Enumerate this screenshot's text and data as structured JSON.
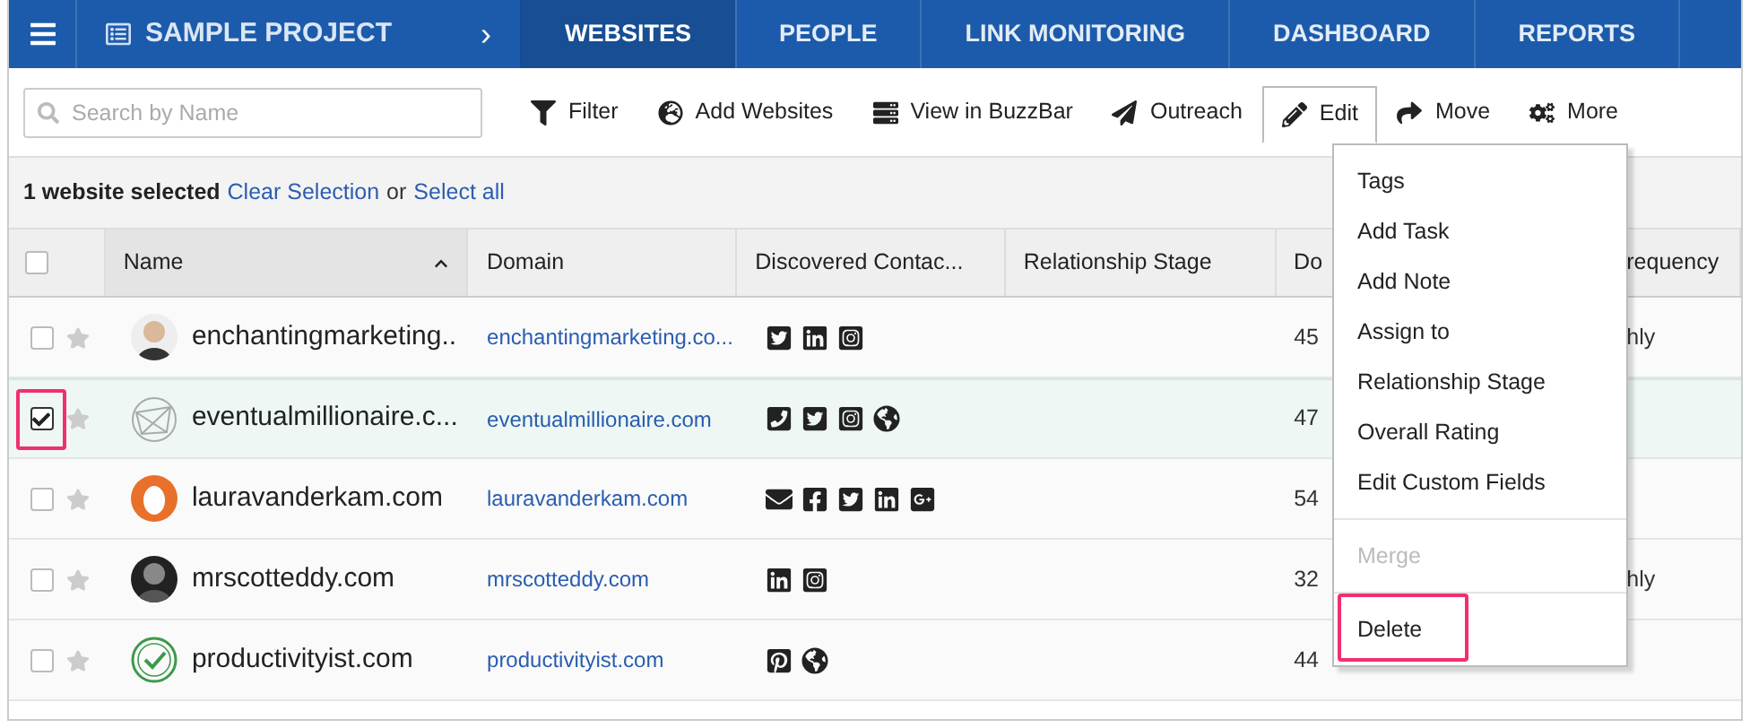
{
  "nav": {
    "project": "SAMPLE PROJECT",
    "chevron": "›",
    "tabs": [
      {
        "label": "WEBSITES",
        "selected": true
      },
      {
        "label": "PEOPLE",
        "selected": false
      },
      {
        "label": "LINK MONITORING",
        "selected": false
      },
      {
        "label": "DASHBOARD",
        "selected": false
      },
      {
        "label": "REPORTS",
        "selected": false
      }
    ]
  },
  "search": {
    "placeholder": "Search by Name"
  },
  "toolbar": [
    {
      "label": "Filter",
      "open": false
    },
    {
      "label": "Add Websites",
      "open": false
    },
    {
      "label": "View in BuzzBar",
      "open": false
    },
    {
      "label": "Outreach",
      "open": false
    },
    {
      "label": "Edit",
      "open": true
    },
    {
      "label": "Move",
      "open": false
    },
    {
      "label": "More",
      "open": false
    }
  ],
  "selection": {
    "count": "1 website selected",
    "clear": "Clear Selection",
    "or": "or",
    "select_all": "Select all"
  },
  "table": {
    "all_checked": false,
    "sort_ascending": true,
    "columns": [
      "Name",
      "Domain",
      "Discovered Contac...",
      "Relationship Stage",
      "Do",
      "requency"
    ],
    "rows": [
      {
        "checked": false,
        "starred": false,
        "avatar": {
          "kind": "photo-light"
        },
        "name": "enchantingmarketing..",
        "domain": "enchantingmarketing.co...",
        "contacts": [
          {
            "kind": "twitter"
          },
          {
            "kind": "linkedin"
          },
          {
            "kind": "instagram"
          }
        ],
        "stage": "",
        "column_5": "45",
        "column_6": "hly"
      },
      {
        "checked": true,
        "starred": false,
        "highlighted": true,
        "avatar": {
          "kind": "globe"
        },
        "name": "eventualmillionaire.c...",
        "domain": "eventualmillionaire.com",
        "contacts": [
          {
            "kind": "phone"
          },
          {
            "kind": "twitter"
          },
          {
            "kind": "instagram"
          },
          {
            "kind": "web"
          }
        ],
        "stage": "",
        "column_5": "47",
        "column_6": ""
      },
      {
        "checked": false,
        "starred": false,
        "avatar": {
          "kind": "egg"
        },
        "name": "lauravanderkam.com",
        "domain": "lauravanderkam.com",
        "contacts": [
          {
            "kind": "email"
          },
          {
            "kind": "facebook"
          },
          {
            "kind": "twitter"
          },
          {
            "kind": "linkedin"
          },
          {
            "kind": "googleplus"
          }
        ],
        "stage": "",
        "column_5": "54",
        "column_6": ""
      },
      {
        "checked": false,
        "starred": false,
        "avatar": {
          "kind": "photo-dark"
        },
        "name": "mrscotteddy.com",
        "domain": "mrscotteddy.com",
        "contacts": [
          {
            "kind": "linkedin"
          },
          {
            "kind": "instagram"
          }
        ],
        "stage": "",
        "column_5": "32",
        "column_6": "hly"
      },
      {
        "checked": false,
        "starred": false,
        "avatar": {
          "kind": "check"
        },
        "name": "productivityist.com",
        "domain": "productivityist.com",
        "contacts": [
          {
            "kind": "pinterest"
          },
          {
            "kind": "web"
          }
        ],
        "stage": "",
        "column_5": "44",
        "column_6": ""
      }
    ]
  },
  "menu": {
    "groups": [
      [
        {
          "label": "Tags",
          "disabled": false,
          "highlighted": false
        },
        {
          "label": "Add Task",
          "disabled": false,
          "highlighted": false
        },
        {
          "label": "Add Note",
          "disabled": false,
          "highlighted": false
        },
        {
          "label": "Assign to",
          "disabled": false,
          "highlighted": false
        },
        {
          "label": "Relationship Stage",
          "disabled": false,
          "highlighted": false
        },
        {
          "label": "Overall Rating",
          "disabled": false,
          "highlighted": false
        },
        {
          "label": "Edit Custom Fields",
          "disabled": false,
          "highlighted": false
        }
      ],
      [
        {
          "label": "Merge",
          "disabled": true,
          "highlighted": false
        }
      ],
      [
        {
          "label": "Delete",
          "disabled": false,
          "highlighted": true
        }
      ]
    ]
  }
}
